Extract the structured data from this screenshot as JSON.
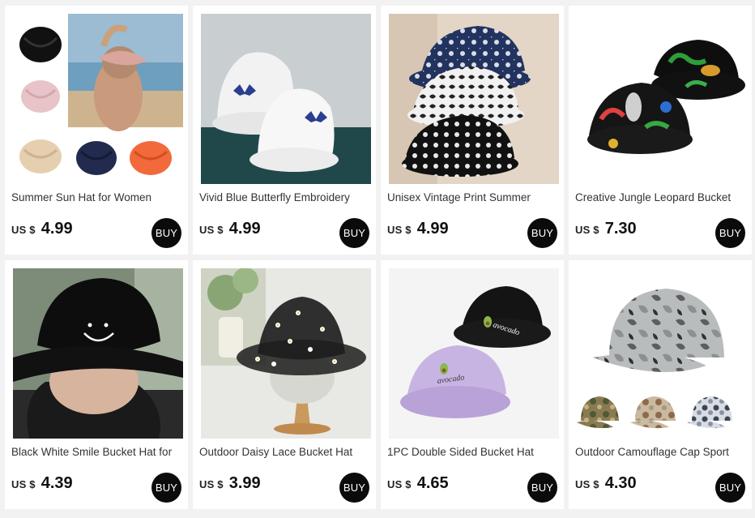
{
  "products": [
    {
      "title": "Summer Sun Hat for Women",
      "currency": "US $",
      "price": "4.99",
      "buy_label": "BUY"
    },
    {
      "title": "Vivid Blue Butterfly Embroidery",
      "currency": "US $",
      "price": "4.99",
      "buy_label": "BUY"
    },
    {
      "title": "Unisex Vintage Print Summer",
      "currency": "US $",
      "price": "4.99",
      "buy_label": "BUY"
    },
    {
      "title": "Creative Jungle Leopard Bucket",
      "currency": "US $",
      "price": "7.30",
      "buy_label": "BUY"
    },
    {
      "title": "Black White Smile Bucket Hat for",
      "currency": "US $",
      "price": "4.39",
      "buy_label": "BUY"
    },
    {
      "title": "Outdoor Daisy Lace Bucket Hat",
      "currency": "US $",
      "price": "3.99",
      "buy_label": "BUY"
    },
    {
      "title": "1PC Double Sided Bucket Hat",
      "currency": "US $",
      "price": "4.65",
      "buy_label": "BUY"
    },
    {
      "title": "Outdoor Camouflage Cap Sport",
      "currency": "US $",
      "price": "4.30",
      "buy_label": "BUY"
    }
  ],
  "image_text": {
    "avocado": "avocado"
  },
  "colors": {
    "background": "#f2f2f2",
    "card": "#ffffff",
    "buy_button": "#0b0b0b"
  }
}
